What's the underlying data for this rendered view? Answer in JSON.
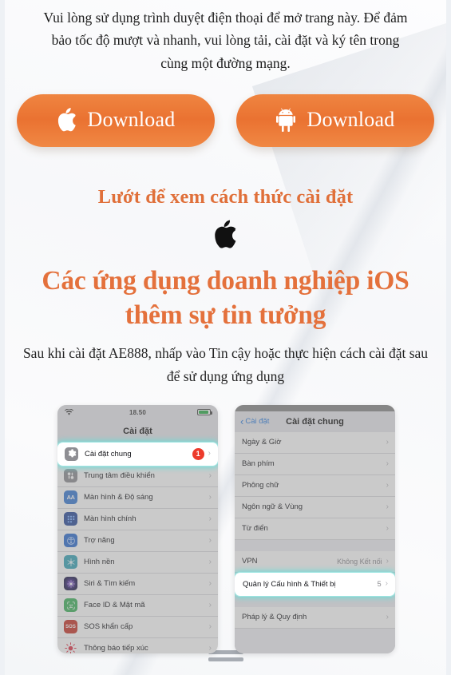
{
  "intro": {
    "text": "Vui lòng sử dụng trình duyệt điện thoại để mở trang này. Để đảm bảo tốc độ mượt và nhanh, vui lòng tải, cài đặt và ký tên trong cùng một đường mạng."
  },
  "downloads": [
    {
      "icon": "apple-icon",
      "label": "Download"
    },
    {
      "icon": "android-icon",
      "label": "Download"
    }
  ],
  "swipe_heading": "Lướt để xem cách thức cài đặt",
  "platform_icon": "apple-logo-icon",
  "main_heading": "Các ứng dụng doanh nghiệp iOS thêm sự tin tưởng",
  "sub_copy": "Sau khi cài đặt AE888, nhấp vào Tin cậy hoặc thực hiện cách cài đặt sau để sử dụng ứng dụng",
  "colors": {
    "accent_orange": "#e4713c",
    "button_orange": "#ea7231",
    "badge_red": "#ec3b2c",
    "highlight_glow": "#6edcd7",
    "ios_blue": "#2f7fe0"
  },
  "phone_left": {
    "status": {
      "wifi_icon": "wifi-icon",
      "time": "18.50",
      "battery_icon": "battery-icon"
    },
    "title": "Cài đặt",
    "rows": [
      {
        "label": "Cài đặt chung",
        "icon": "gear-icon",
        "icon_color": "#8e8e93",
        "badge": "1",
        "highlight": true
      },
      {
        "label": "Trung tâm điều khiển",
        "icon": "control-center-icon",
        "icon_color": "#8e8e93"
      },
      {
        "label": "Màn hình & Độ sáng",
        "icon": "display-aa-icon",
        "icon_color": "#3a7bd5"
      },
      {
        "label": "Màn hình chính",
        "icon": "home-screen-icon",
        "icon_color": "#2b4c9b"
      },
      {
        "label": "Trợ năng",
        "icon": "accessibility-icon",
        "icon_color": "#2f6fd0"
      },
      {
        "label": "Hình nền",
        "icon": "wallpaper-icon",
        "icon_color": "#3aa6b9"
      },
      {
        "label": "Siri & Tìm kiếm",
        "icon": "siri-icon",
        "icon_color": "#1c1c3a"
      },
      {
        "label": "Face ID & Mật mã",
        "icon": "face-id-icon",
        "icon_color": "#41b35d"
      },
      {
        "label": "SOS khẩn cấp",
        "icon": "sos-icon",
        "icon_color": "#c9372c"
      },
      {
        "label": "Thông báo tiếp xúc",
        "icon": "exposure-notification-icon",
        "icon_color": "#e0374a"
      }
    ]
  },
  "phone_right": {
    "back_label": "Cài đặt",
    "title": "Cài đặt chung",
    "rows": [
      {
        "label": "Ngày & Giờ"
      },
      {
        "label": "Bàn phím"
      },
      {
        "label": "Phông chữ"
      },
      {
        "label": "Ngôn ngữ & Vùng"
      },
      {
        "label": "Từ điển"
      },
      {
        "label": "VPN",
        "value": "Không Kết nối",
        "group_start": true
      },
      {
        "label": "Quản lý Cấu hình & Thiết bị",
        "value": "5",
        "highlight": true
      },
      {
        "label": "Pháp lý & Quy định",
        "group_start": true
      }
    ]
  },
  "bottom_handle": "drag-handle"
}
